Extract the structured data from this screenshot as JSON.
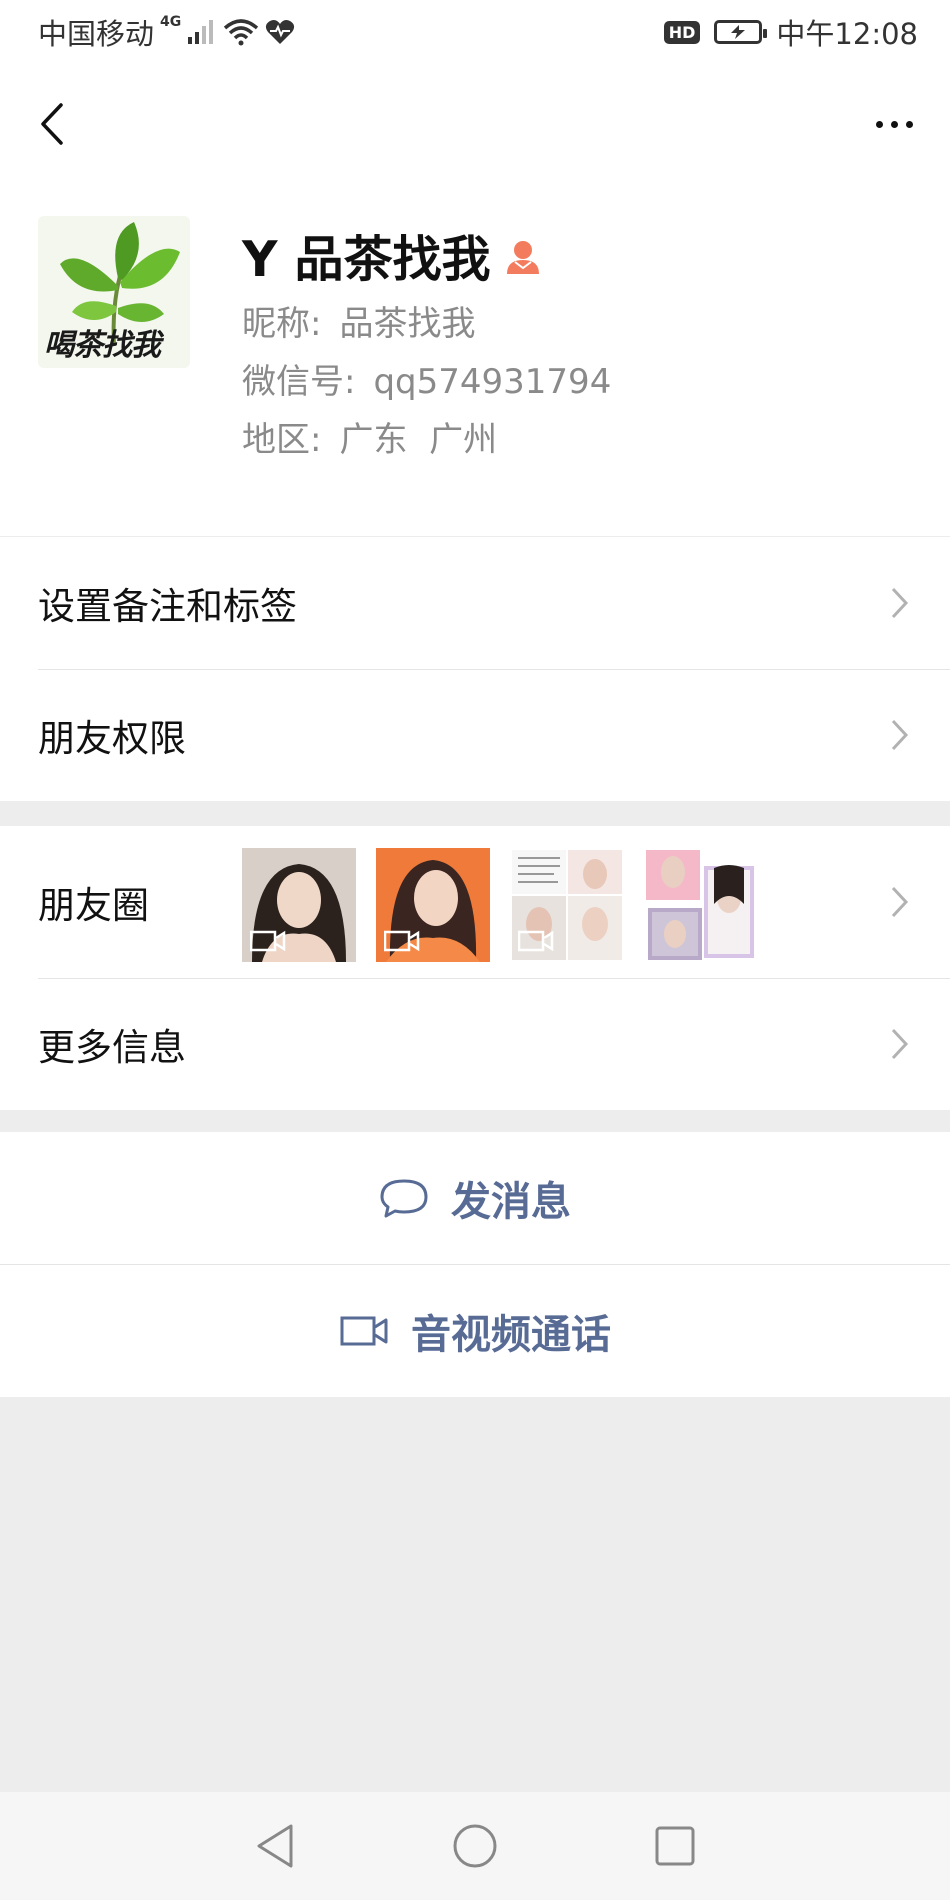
{
  "status_bar": {
    "carrier": "中国移动",
    "network": "4G",
    "hd_badge": "HD",
    "time": "中午12:08"
  },
  "header": {
    "back_icon": "chevron-left-icon",
    "more_icon": "ellipsis-icon"
  },
  "profile": {
    "avatar_text": "喝茶找我",
    "display_name": "Y 品茶找我",
    "gender_icon": "female-icon",
    "gender_color": "#f37b5e",
    "nickname_label": "昵称:",
    "nickname": "品茶找我",
    "wechat_id_label": "微信号:",
    "wechat_id": "qq574931794",
    "region_label": "地区:",
    "region": "广东  广州"
  },
  "settings": {
    "remark_tags": "设置备注和标签",
    "friend_permissions": "朋友权限"
  },
  "moments": {
    "label": "朋友圈",
    "thumbnails": [
      {
        "kind": "video"
      },
      {
        "kind": "video"
      },
      {
        "kind": "collage"
      },
      {
        "kind": "collage"
      }
    ]
  },
  "more_info": {
    "label": "更多信息"
  },
  "actions": {
    "message": "发消息",
    "call": "音视频通话"
  },
  "colors": {
    "link_blue": "#576b95",
    "background": "#ededed"
  }
}
